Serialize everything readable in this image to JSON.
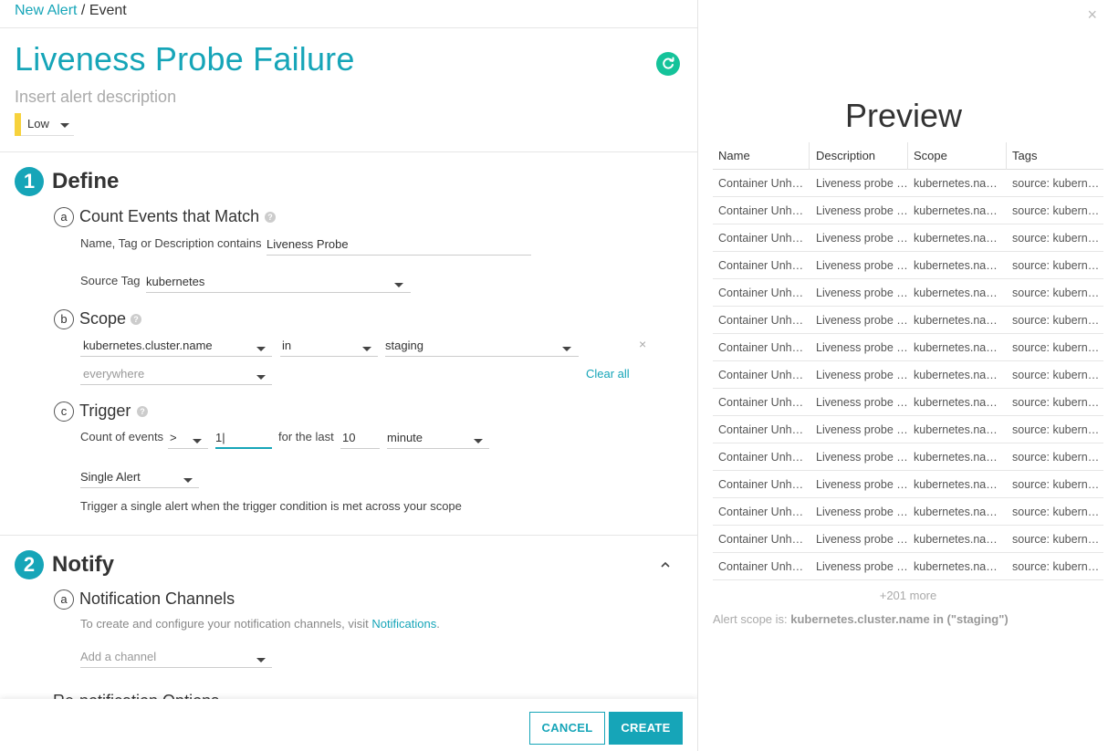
{
  "breadcrumb": {
    "link": "New Alert",
    "sep": " / ",
    "current": "Event"
  },
  "alert": {
    "title": "Liveness Probe Failure",
    "description_placeholder": "Insert alert description",
    "severity": "Low"
  },
  "define": {
    "num": "1",
    "title": "Define",
    "match": {
      "letter": "a",
      "title": "Count Events that Match",
      "name_label": "Name, Tag or Description contains",
      "name_value": "Liveness Probe",
      "source_label": "Source Tag",
      "source_value": "kubernetes"
    },
    "scope": {
      "letter": "b",
      "title": "Scope",
      "key": "kubernetes.cluster.name",
      "op": "in",
      "value": "staging",
      "remove": "×",
      "next_placeholder": "everywhere",
      "clear_all": "Clear all"
    },
    "trigger": {
      "letter": "c",
      "title": "Trigger",
      "count_label": "Count of events",
      "operator": ">",
      "threshold": "1",
      "for_label": "for the last",
      "duration": "10",
      "unit": "minute",
      "alert_mode": "Single Alert",
      "help": "Trigger a single alert when the trigger condition is met across your scope"
    }
  },
  "notify": {
    "num": "2",
    "title": "Notify",
    "collapse": "^",
    "channels": {
      "letter": "a",
      "title": "Notification Channels",
      "text": "To create and configure your notification channels, visit ",
      "link": "Notifications",
      "period": ".",
      "placeholder": "Add a channel"
    },
    "renotify_title": "Re-notification Options"
  },
  "footer": {
    "cancel": "CANCEL",
    "create": "CREATE"
  },
  "preview": {
    "close": "×",
    "title": "Preview",
    "columns": [
      "Name",
      "Description",
      "Scope",
      "Tags"
    ],
    "rows": [
      [
        "Container Unhealthy",
        "Liveness probe failed",
        "kubernetes.namespace",
        "source: kubernetes"
      ],
      [
        "Container Unhealthy",
        "Liveness probe failed",
        "kubernetes.namespace",
        "source: kubernetes"
      ],
      [
        "Container Unhealthy",
        "Liveness probe failed",
        "kubernetes.namespace",
        "source: kubernetes"
      ],
      [
        "Container Unhealthy",
        "Liveness probe failed",
        "kubernetes.namespace",
        "source: kubernetes"
      ],
      [
        "Container Unhealthy",
        "Liveness probe failed",
        "kubernetes.namespace",
        "source: kubernetes"
      ],
      [
        "Container Unhealthy",
        "Liveness probe failed",
        "kubernetes.namespace",
        "source: kubernetes"
      ],
      [
        "Container Unhealthy",
        "Liveness probe failed",
        "kubernetes.namespace",
        "source: kubernetes"
      ],
      [
        "Container Unhealthy",
        "Liveness probe failed",
        "kubernetes.namespace",
        "source: kubernetes"
      ],
      [
        "Container Unhealthy",
        "Liveness probe failed",
        "kubernetes.namespace",
        "source: kubernetes"
      ],
      [
        "Container Unhealthy",
        "Liveness probe failed",
        "kubernetes.namespace",
        "source: kubernetes"
      ],
      [
        "Container Unhealthy",
        "Liveness probe failed",
        "kubernetes.namespace",
        "source: kubernetes"
      ],
      [
        "Container Unhealthy",
        "Liveness probe failed",
        "kubernetes.namespace",
        "source: kubernetes"
      ],
      [
        "Container Unhealthy",
        "Liveness probe failed",
        "kubernetes.namespace",
        "source: kubernetes"
      ],
      [
        "Container Unhealthy",
        "Liveness probe failed",
        "kubernetes.namespace",
        "source: kubernetes"
      ],
      [
        "Container Unhealthy",
        "Liveness probe failed",
        "kubernetes.namespace",
        "source: kubernetes"
      ]
    ],
    "more": "+201 more",
    "scope_prefix": "Alert scope is: ",
    "scope_value": "kubernetes.cluster.name in (\"staging\")"
  },
  "colors": {
    "accent": "#16a5b8",
    "severity_low": "#f7d23c",
    "refresh": "#15c39a"
  },
  "icons": {
    "refresh": "refresh-icon",
    "help": "help-icon",
    "caret": "caret-down-icon",
    "close": "close-icon"
  }
}
